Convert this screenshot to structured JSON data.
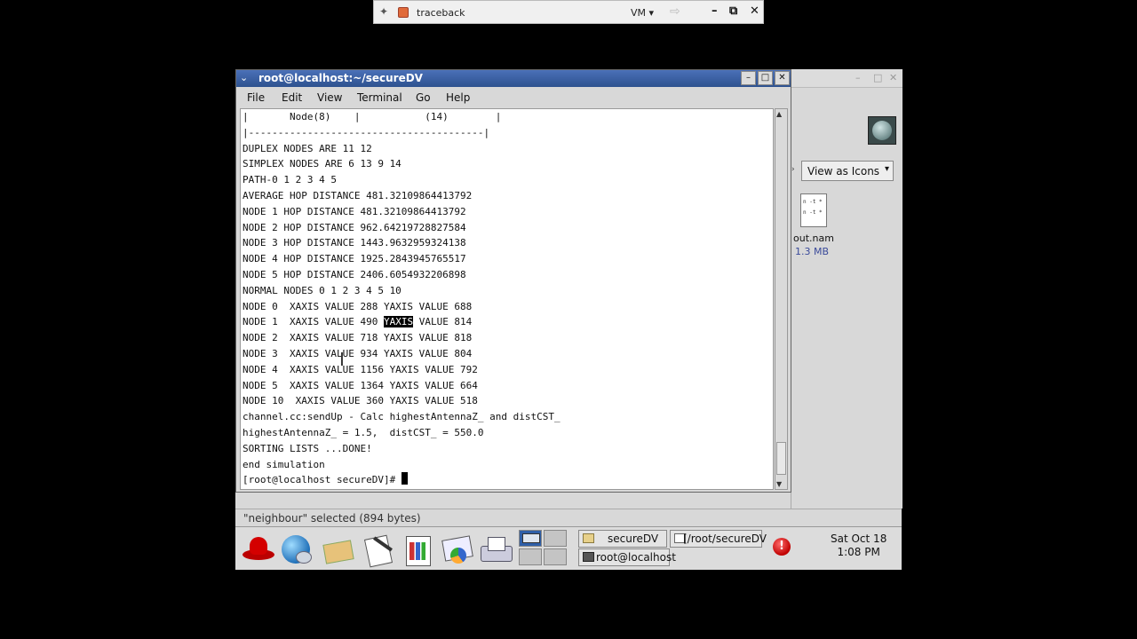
{
  "remote_bar": {
    "title": "traceback",
    "vm_label": "VM ▾",
    "pin_glyph": "✦",
    "forward_glyph": "⇨",
    "minimize_glyph": "–",
    "restore_glyph": "⧉",
    "close_glyph": "✕"
  },
  "terminal": {
    "title": "root@localhost:~/secureDV",
    "menu_glyph": "⌄",
    "btn_minimize": "–",
    "btn_maximize": "□",
    "btn_close": "✕",
    "menu": [
      "File",
      "Edit",
      "View",
      "Terminal",
      "Go",
      "Help"
    ],
    "lines": [
      "|       Node(8)    |           (14)        |",
      "|----------------------------------------|",
      "DUPLEX NODES ARE 11 12",
      "SIMPLEX NODES ARE 6 13 9 14",
      "PATH-0 1 2 3 4 5",
      "AVERAGE HOP DISTANCE 481.32109864413792",
      "NODE 1 HOP DISTANCE 481.32109864413792",
      "NODE 2 HOP DISTANCE 962.64219728827584",
      "NODE 3 HOP DISTANCE 1443.9632959324138",
      "NODE 4 HOP DISTANCE 1925.2843945765517",
      "NODE 5 HOP DISTANCE 2406.6054932206898",
      "NORMAL NODES 0 1 2 3 4 5 10",
      "NODE 0  XAXIS VALUE 288 YAXIS VALUE 688",
      "NODE 1  XAXIS VALUE 490 YAXIS VALUE 814",
      "NODE 2  XAXIS VALUE 718 YAXIS VALUE 818",
      "NODE 3  XAXIS VALUE 934 YAXIS VALUE 804",
      "NODE 4  XAXIS VALUE 1156 YAXIS VALUE 792",
      "NODE 5  XAXIS VALUE 1364 YAXIS VALUE 664",
      "NODE 10  XAXIS VALUE 360 YAXIS VALUE 518",
      "channel.cc:sendUp - Calc highestAntennaZ_ and distCST_",
      "highestAntennaZ_ = 1.5,  distCST_ = 550.0",
      "SORTING LISTS ...DONE!",
      "end simulation",
      "[root@localhost secureDV]# "
    ],
    "highlight": {
      "line": 13,
      "text": "YAXIS"
    },
    "scroll_up_glyph": "▲",
    "scroll_down_glyph": "▼",
    "ibeam_glyph": "I"
  },
  "background_window": {
    "view_select": "View as Icons",
    "view_select_arrow": "▾",
    "side_arrow_glyph": "›",
    "file_icon_text": [
      "n -t *",
      "n -t *"
    ],
    "file_name": "out.nam",
    "file_size": "1.3 MB",
    "btn_minimize": "–",
    "btn_maximize": "□",
    "btn_close": "✕"
  },
  "status": "\"neighbour\" selected (894 bytes)",
  "panel": {
    "launchers": [
      "redhat-menu-icon",
      "web-browser-icon",
      "email-icon",
      "text-editor-icon",
      "spreadsheet-icon",
      "presentation-icon",
      "print-manager-icon"
    ],
    "tasks": [
      {
        "label": "secureDV",
        "icon": "folder-icon"
      },
      {
        "label": "[/root/secureDV",
        "icon": "file-browser-icon"
      },
      {
        "label": "root@localhost",
        "icon": "terminal-icon"
      }
    ],
    "alert_glyph": "!",
    "clock_date": "Sat Oct 18",
    "clock_time": "1:08 PM"
  }
}
